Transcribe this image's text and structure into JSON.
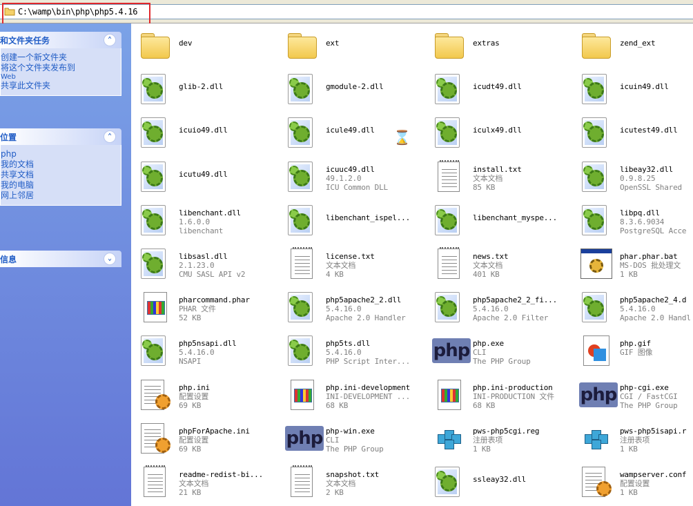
{
  "address": {
    "path": "C:\\wamp\\bin\\php\\php5.4.16"
  },
  "sidebar": {
    "panels": [
      {
        "title": "和文件夹任务",
        "chevron": "⌃",
        "items": [
          "创建一个新文件夹",
          "将这个文件夹发布到",
          "Web",
          "共享此文件夹"
        ]
      },
      {
        "title": "位置",
        "chevron": "⌃",
        "items": [
          "php",
          "我的文档",
          "共享文档",
          "我的电脑",
          "网上邻居"
        ]
      },
      {
        "title": "信息",
        "chevron": "⌄",
        "items": []
      }
    ]
  },
  "files": [
    {
      "name": "dev",
      "l2": "",
      "l3": "",
      "icon": "folder-icon"
    },
    {
      "name": "ext",
      "l2": "",
      "l3": "",
      "icon": "folder-icon"
    },
    {
      "name": "extras",
      "l2": "",
      "l3": "",
      "icon": "folder-icon"
    },
    {
      "name": "zend_ext",
      "l2": "",
      "l3": "",
      "icon": "folder-icon"
    },
    {
      "name": "glib-2.dll",
      "l2": "",
      "l3": "",
      "icon": "dll-icon"
    },
    {
      "name": "gmodule-2.dll",
      "l2": "",
      "l3": "",
      "icon": "dll-icon"
    },
    {
      "name": "icudt49.dll",
      "l2": "",
      "l3": "",
      "icon": "dll-icon"
    },
    {
      "name": "icuin49.dll",
      "l2": "",
      "l3": "",
      "icon": "dll-icon"
    },
    {
      "name": "icuio49.dll",
      "l2": "",
      "l3": "",
      "icon": "dll-icon"
    },
    {
      "name": "icule49.dll",
      "l2": "",
      "l3": "",
      "icon": "dll-icon"
    },
    {
      "name": "iculx49.dll",
      "l2": "",
      "l3": "",
      "icon": "dll-icon"
    },
    {
      "name": "icutest49.dll",
      "l2": "",
      "l3": "",
      "icon": "dll-icon"
    },
    {
      "name": "icutu49.dll",
      "l2": "",
      "l3": "",
      "icon": "dll-icon"
    },
    {
      "name": "icuuc49.dll",
      "l2": "49.1.2.0",
      "l3": "ICU Common DLL",
      "icon": "dll-icon"
    },
    {
      "name": "install.txt",
      "l2": "文本文档",
      "l3": "85 KB",
      "icon": "text-doc-icon"
    },
    {
      "name": "libeay32.dll",
      "l2": "0.9.8.25",
      "l3": "OpenSSL Shared",
      "icon": "dll-icon"
    },
    {
      "name": "libenchant.dll",
      "l2": "1.6.0.0",
      "l3": "libenchant",
      "icon": "dll-icon"
    },
    {
      "name": "libenchant_ispel...",
      "l2": "",
      "l3": "",
      "icon": "dll-icon"
    },
    {
      "name": "libenchant_myspe...",
      "l2": "",
      "l3": "",
      "icon": "dll-icon"
    },
    {
      "name": "libpq.dll",
      "l2": "8.3.6.9034",
      "l3": "PostgreSQL Acce",
      "icon": "dll-icon"
    },
    {
      "name": "libsasl.dll",
      "l2": "2.1.23.0",
      "l3": "CMU SASL API v2",
      "icon": "dll-icon"
    },
    {
      "name": "license.txt",
      "l2": "文本文档",
      "l3": "4 KB",
      "icon": "text-doc-icon"
    },
    {
      "name": "news.txt",
      "l2": "文本文档",
      "l3": "401 KB",
      "icon": "text-doc-icon"
    },
    {
      "name": "phar.phar.bat",
      "l2": "MS-DOS 批处理文",
      "l3": "1 KB",
      "icon": "batch-icon"
    },
    {
      "name": "pharcommand.phar",
      "l2": "PHAR 文件",
      "l3": "52 KB",
      "icon": "window-doc-icon"
    },
    {
      "name": "php5apache2_2.dll",
      "l2": "5.4.16.0",
      "l3": "Apache 2.0 Handler",
      "icon": "dll-icon"
    },
    {
      "name": "php5apache2_2_fi...",
      "l2": "5.4.16.0",
      "l3": "Apache 2.0 Filter",
      "icon": "dll-icon"
    },
    {
      "name": "php5apache2_4.d",
      "l2": "5.4.16.0",
      "l3": "Apache 2.0 Handl",
      "icon": "dll-icon"
    },
    {
      "name": "php5nsapi.dll",
      "l2": "5.4.16.0",
      "l3": "NSAPI",
      "icon": "dll-icon"
    },
    {
      "name": "php5ts.dll",
      "l2": "5.4.16.0",
      "l3": "PHP Script Inter...",
      "icon": "dll-icon"
    },
    {
      "name": "php.exe",
      "l2": "CLI",
      "l3": "The PHP Group",
      "icon": "php-icon"
    },
    {
      "name": "php.gif",
      "l2": "GIF 图像",
      "l3": "",
      "icon": "gif-icon"
    },
    {
      "name": "php.ini",
      "l2": "配置设置",
      "l3": "69 KB",
      "icon": "ini-icon"
    },
    {
      "name": "php.ini-development",
      "l2": "INI-DEVELOPMENT ...",
      "l3": "68 KB",
      "icon": "window-doc-icon"
    },
    {
      "name": "php.ini-production",
      "l2": "INI-PRODUCTION 文件",
      "l3": "68 KB",
      "icon": "window-doc-icon"
    },
    {
      "name": "php-cgi.exe",
      "l2": "CGI / FastCGI",
      "l3": "The PHP Group",
      "icon": "php-icon"
    },
    {
      "name": "phpForApache.ini",
      "l2": "配置设置",
      "l3": "69 KB",
      "icon": "ini-icon"
    },
    {
      "name": "php-win.exe",
      "l2": "CLI",
      "l3": "The PHP Group",
      "icon": "php-icon"
    },
    {
      "name": "pws-php5cgi.reg",
      "l2": "注册表项",
      "l3": "1 KB",
      "icon": "registry-icon"
    },
    {
      "name": "pws-php5isapi.r",
      "l2": "注册表项",
      "l3": "1 KB",
      "icon": "registry-icon"
    },
    {
      "name": "readme-redist-bi...",
      "l2": "文本文档",
      "l3": "21 KB",
      "icon": "text-doc-icon"
    },
    {
      "name": "snapshot.txt",
      "l2": "文本文档",
      "l3": "2 KB",
      "icon": "text-doc-icon"
    },
    {
      "name": "ssleay32.dll",
      "l2": "",
      "l3": "",
      "icon": "dll-icon"
    },
    {
      "name": "wampserver.conf",
      "l2": "配置设置",
      "l3": "1 KB",
      "icon": "ini-icon"
    }
  ],
  "colors": {
    "sidebar_top": "#7ba2e7",
    "sidebar_bottom": "#6375d6",
    "panel_link": "#215dc6",
    "highlight": "#e0282c"
  }
}
